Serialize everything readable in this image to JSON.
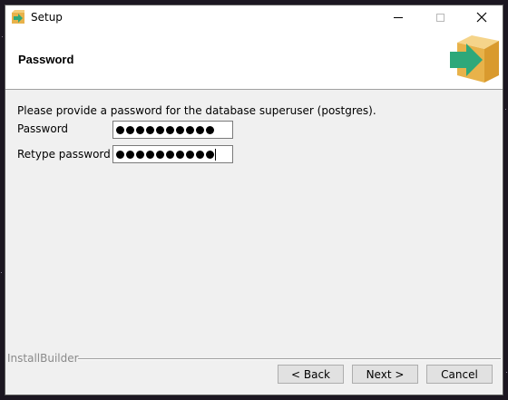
{
  "window": {
    "title": "Setup",
    "icon": "installer-box-icon"
  },
  "header": {
    "title": "Password",
    "logo": "installer-box-arrow-icon"
  },
  "form": {
    "description": "Please provide a password for the database superuser (postgres).",
    "password_label": "Password",
    "password_mask_length": 10,
    "retype_label": "Retype password",
    "retype_mask_length": 10
  },
  "footer": {
    "brand": "InstallBuilder",
    "back_label": "< Back",
    "next_label": "Next >",
    "cancel_label": "Cancel"
  },
  "colors": {
    "box_tan": "#e8b24a",
    "arrow_green": "#2ea87a",
    "window_bg": "#f0f0f0"
  }
}
